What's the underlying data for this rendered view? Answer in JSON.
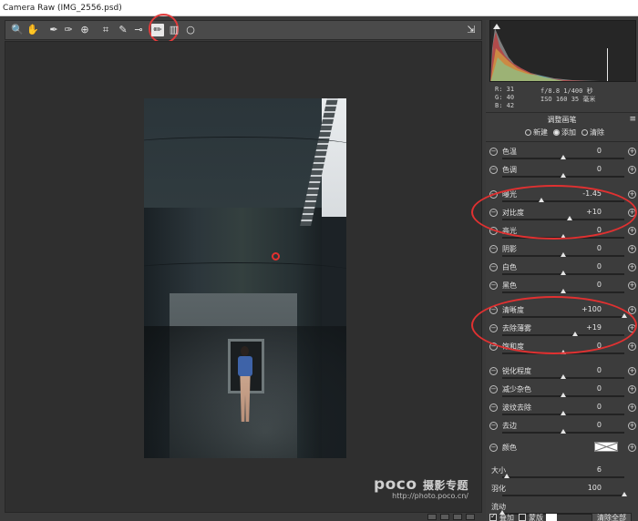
{
  "window": {
    "title": "Camera Raw (IMG_2556.psd)"
  },
  "toolbar": {
    "tools": [
      {
        "name": "zoom-tool",
        "icon": "magnifier-icon",
        "glyph": "🔍"
      },
      {
        "name": "hand-tool",
        "icon": "hand-icon",
        "glyph": "✋"
      },
      {
        "name": "white-balance-tool",
        "icon": "eyedropper-icon",
        "glyph": "✒"
      },
      {
        "name": "color-sampler-tool",
        "icon": "color-sampler-icon",
        "glyph": "✑"
      },
      {
        "name": "targeted-adjustment-tool",
        "icon": "target-adjust-icon",
        "glyph": "⊕"
      },
      {
        "name": "crop-tool",
        "icon": "crop-icon",
        "glyph": "⌗"
      },
      {
        "name": "spot-removal-tool",
        "icon": "spot-removal-icon",
        "glyph": "✎"
      },
      {
        "name": "red-eye-tool",
        "icon": "red-eye-icon",
        "glyph": "⊸"
      },
      {
        "name": "adjustment-brush-tool",
        "icon": "brush-icon",
        "glyph": "✏",
        "active": true
      },
      {
        "name": "graduated-filter-tool",
        "icon": "graduated-filter-icon",
        "glyph": "▥"
      },
      {
        "name": "radial-filter-tool",
        "icon": "radial-filter-icon",
        "glyph": "○"
      }
    ]
  },
  "watermark": {
    "logo": "poco",
    "logo_sub": "摄影专题",
    "url": "http://photo.poco.cn/"
  },
  "readout": {
    "r_label": "R:",
    "r": "31",
    "g_label": "G:",
    "g": "40",
    "b_label": "B:",
    "b": "42",
    "camera_line1": "f/8.8  1/400 秒",
    "camera_line2": "ISO 160  35 毫米"
  },
  "panel": {
    "title": "调整画笔",
    "modes": [
      {
        "label": "新建",
        "on": false
      },
      {
        "label": "添加",
        "on": true
      },
      {
        "label": "清除",
        "on": false
      }
    ],
    "sliders": [
      {
        "key": "color-temp",
        "label": "色温",
        "value": "0",
        "pos": 0.5
      },
      {
        "key": "tint",
        "label": "色调",
        "value": "0",
        "pos": 0.5
      },
      {
        "key": "exposure",
        "label": "曝光",
        "value": "-1.45",
        "pos": 0.32
      },
      {
        "key": "contrast",
        "label": "对比度",
        "value": "+10",
        "pos": 0.55
      },
      {
        "key": "highlights",
        "label": "高光",
        "value": "0",
        "pos": 0.5
      },
      {
        "key": "shadows",
        "label": "阴影",
        "value": "0",
        "pos": 0.5
      },
      {
        "key": "whites",
        "label": "白色",
        "value": "0",
        "pos": 0.5
      },
      {
        "key": "blacks",
        "label": "黑色",
        "value": "0",
        "pos": 0.5
      },
      {
        "key": "clarity",
        "label": "清晰度",
        "value": "+100",
        "pos": 1.0
      },
      {
        "key": "dehaze",
        "label": "去除薄雾",
        "value": "+19",
        "pos": 0.6
      },
      {
        "key": "saturation",
        "label": "饱和度",
        "value": "0",
        "pos": 0.5
      },
      {
        "key": "sharpness",
        "label": "锐化程度",
        "value": "0",
        "pos": 0.5
      },
      {
        "key": "noise-reduction",
        "label": "减少杂色",
        "value": "0",
        "pos": 0.5
      },
      {
        "key": "moire-reduction",
        "label": "波纹去除",
        "value": "0",
        "pos": 0.5
      },
      {
        "key": "defringe",
        "label": "去边",
        "value": "0",
        "pos": 0.5
      }
    ],
    "color_label": "颜色",
    "brush": [
      {
        "key": "size",
        "label": "大小",
        "value": "6",
        "pos": 0.04
      },
      {
        "key": "feather",
        "label": "羽化",
        "value": "100",
        "pos": 1.0
      },
      {
        "key": "flow",
        "label": "流动",
        "value": "",
        "pos": 0.0
      }
    ],
    "bottom": {
      "overlay_label": "叠加",
      "mask_label": "蒙版",
      "clear_all_label": "清除全部"
    }
  },
  "colors": {
    "accent_red": "#e03131",
    "panel_bg": "#3c3c3c",
    "canvas_bg": "#2f2f2f"
  }
}
